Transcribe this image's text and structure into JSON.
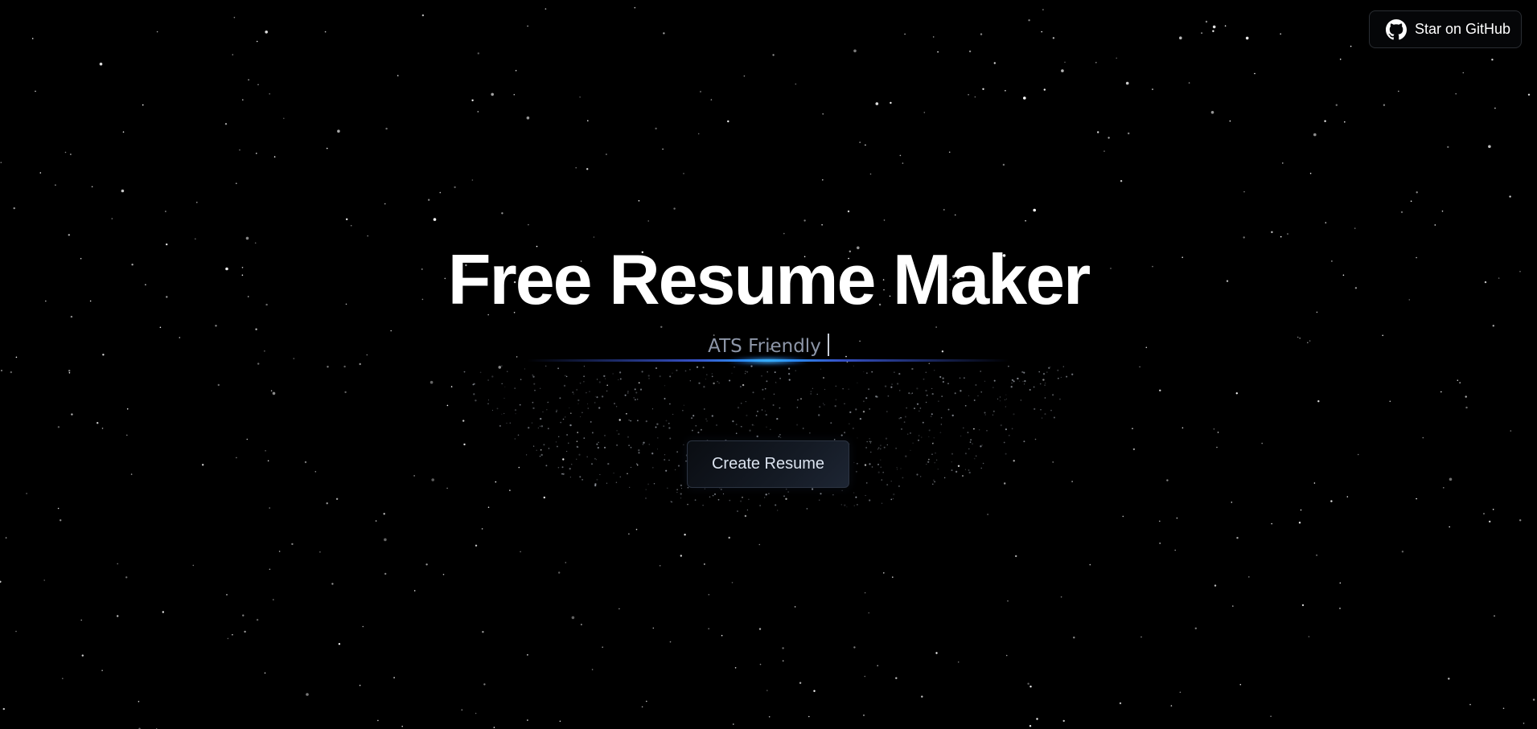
{
  "header": {
    "github_button": {
      "label": "Star on GitHub",
      "icon": "github-icon"
    }
  },
  "hero": {
    "title": "Free Resume Maker",
    "subtitle": "ATS Friendly",
    "cta_label": "Create Resume"
  },
  "colors": {
    "background": "#000000",
    "title": "#ffffff",
    "subtitle": "#8d96a8",
    "accent_glow": "#28aaff"
  }
}
